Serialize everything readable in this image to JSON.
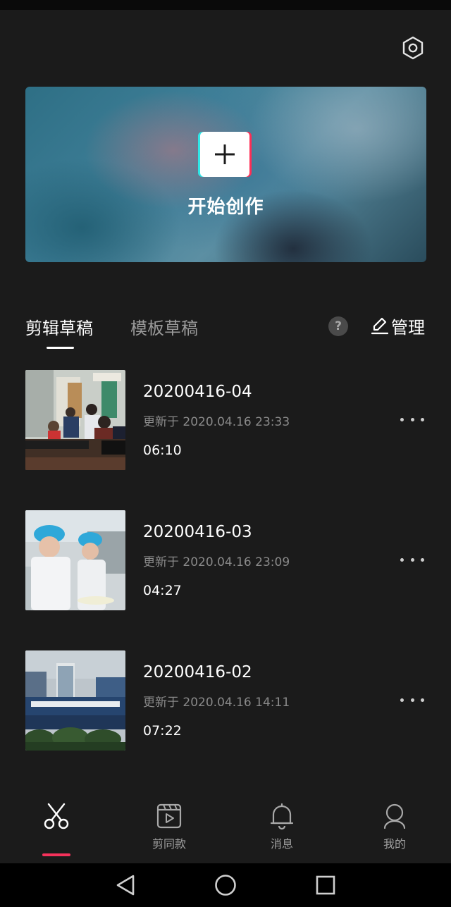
{
  "header": {
    "settings_icon": "hexagon-gear-icon"
  },
  "banner": {
    "label": "开始创作",
    "plus_icon": "plus-icon"
  },
  "tabs": {
    "items": [
      {
        "label": "剪辑草稿",
        "active": true
      },
      {
        "label": "模板草稿",
        "active": false
      }
    ],
    "help_label": "?",
    "manage_label": "管理"
  },
  "drafts": [
    {
      "title": "20200416-04",
      "updated": "更新于 2020.04.16 23:33",
      "duration": "06:10"
    },
    {
      "title": "20200416-03",
      "updated": "更新于 2020.04.16 23:09",
      "duration": "04:27"
    },
    {
      "title": "20200416-02",
      "updated": "更新于 2020.04.16 14:11",
      "duration": "07:22"
    }
  ],
  "bottom_nav": [
    {
      "label": "",
      "icon": "scissors-icon",
      "active": true
    },
    {
      "label": "剪同款",
      "icon": "clapperboard-play-icon",
      "active": false
    },
    {
      "label": "消息",
      "icon": "bell-icon",
      "active": false
    },
    {
      "label": "我的",
      "icon": "person-icon",
      "active": false
    }
  ],
  "colors": {
    "accent": "#f5325b",
    "background": "#1b1b1b"
  }
}
